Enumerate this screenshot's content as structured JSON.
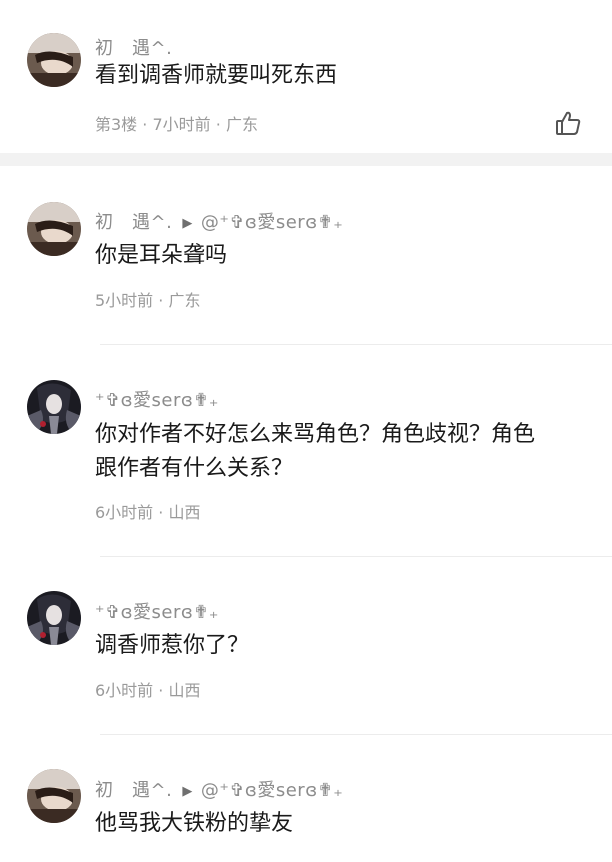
{
  "main_comment": {
    "user": "初　遇^.",
    "text": "看到调香师就要叫死东西",
    "floor": "第3楼",
    "time": "7小时前",
    "location": "广东",
    "dot": "·",
    "like_icon": "thumbs-up-icon"
  },
  "replies": [
    {
      "user": "初　遇^.",
      "arrow": "▶",
      "reply_to": "@⁺✞ɞ愛serɞ✟₊",
      "text": "你是耳朵聋吗",
      "time": "5小时前",
      "location": "广东",
      "dot": "·"
    },
    {
      "user": "⁺✞ɞ愛serɞ✟₊",
      "text_line1": "你对作者不好怎么来骂角色？角色歧视？角色",
      "text_line2": "跟作者有什么关系？",
      "time": "6小时前",
      "location": "山西",
      "dot": "·"
    },
    {
      "user": "⁺✞ɞ愛serɞ✟₊",
      "text": "调香师惹你了？",
      "time": "6小时前",
      "location": "山西",
      "dot": "·"
    },
    {
      "user": "初　遇^.",
      "arrow": "▶",
      "reply_to": "@⁺✞ɞ愛serɞ✟₊",
      "text": "他骂我大铁粉的挚友"
    }
  ]
}
